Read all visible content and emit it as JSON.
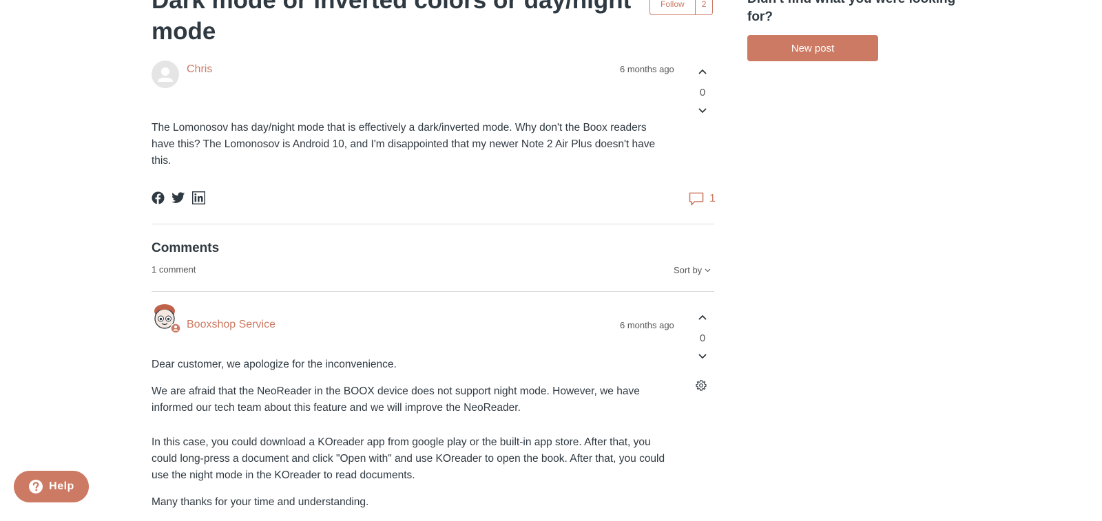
{
  "post": {
    "title": "Dark mode or inverted colors or day/night mode",
    "follow_label": "Follow",
    "follower_count": "2",
    "author": "Chris",
    "time": "6 months ago",
    "votes": "0",
    "body": "The Lomonosov has day/night mode that is effectively a dark/inverted mode. Why don't the Boox readers have this?  The Lomonosov is Android 10, and I'm disappointed that my newer Note 2 Air Plus doesn't have this.",
    "comment_count": "1",
    "share_icons": [
      "facebook-icon",
      "twitter-icon",
      "linkedin-icon"
    ]
  },
  "comments_section": {
    "heading": "Comments",
    "count_label": "1 comment",
    "sort_label": "Sort by"
  },
  "comment": {
    "author": "Booxshop Service",
    "time": "6 months ago",
    "votes": "0",
    "paragraphs": [
      "Dear customer, we apologize for the inconvenience.",
      "We are afraid that the NeoReader in the BOOX device does not support night mode. However, we have informed our tech team about this feature and we will improve the NeoReader.",
      "In this case, you could download a KOreader app from google play or the built-in app store. After that, you could long-press a document and click \"Open with\" and use KOreader to open the book. After that, you could use the night mode in the KOreader to read documents.",
      "Many thanks for your time and understanding."
    ]
  },
  "sidebar": {
    "question": "Didn't find what you were looking for?",
    "new_post_label": "New post"
  },
  "help": {
    "label": "Help"
  },
  "colors": {
    "accent": "#cc7a63",
    "text": "#2f3941",
    "muted": "#555555",
    "divider": "#d8dcde"
  }
}
